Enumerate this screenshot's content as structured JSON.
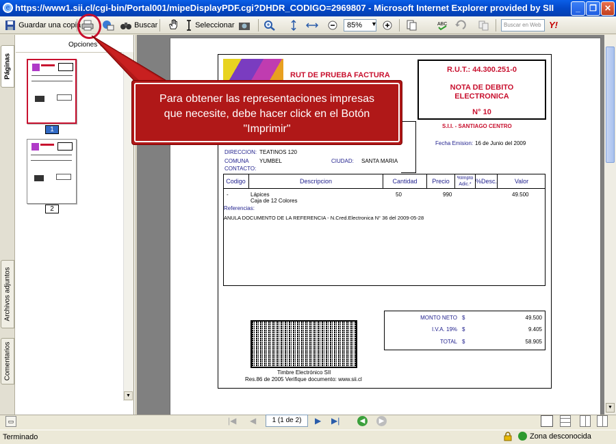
{
  "window": {
    "title": "https://www1.sii.cl/cgi-bin/Portal001/mipeDisplayPDF.cgi?DHDR_CODIGO=2969807 - Microsoft Internet Explorer provided by SII"
  },
  "toolbar": {
    "save_label": "Guardar una copia",
    "search_label": "Buscar",
    "select_label": "Seleccionar",
    "zoom_value": "85%",
    "search_web_placeholder": "Buscar en Web",
    "yahoo_label": "Y!"
  },
  "left_tabs": {
    "pages": "Páginas",
    "attachments": "Archivos adjuntos",
    "comments": "Comentarios"
  },
  "pages_panel": {
    "options_label": "Opciones ▾",
    "thumbnails": [
      {
        "page": "1"
      },
      {
        "page": "2"
      }
    ]
  },
  "callout": {
    "text_lines": [
      "Para obtener las representaciones impresas",
      "que necesite, debe hacer click en el Botón",
      "\"Imprimir\""
    ]
  },
  "document": {
    "issuer": "RUT DE PRUEBA FACTURA",
    "rut_box": {
      "rut": "R.U.T.: 44.300.251-0",
      "doc_type": "NOTA DE DEBITO",
      "doc_type2": "ELECTRONICA",
      "number": "N° 10"
    },
    "office": "S.I.I. - SANTIAGO CENTRO",
    "emission_label": "Fecha Emision:",
    "emission_date": "16 de Junio del 2009",
    "client": {
      "direccion_label": "DIRECCION:",
      "direccion": "TEATINOS 120",
      "comuna_label": "COMUNA",
      "comuna": "YUMBEL",
      "ciudad_label": "CIUDAD:",
      "ciudad": "SANTA MARIA",
      "contacto_label": "CONTACTO:"
    },
    "table_headers": [
      "Codigo",
      "Descripcion",
      "Cantidad",
      "Precio",
      "%Impto Adic.*",
      "%Desc.",
      "Valor"
    ],
    "rows": [
      {
        "codigo": "-",
        "descripcion": "Lápices",
        "descripcion2": "Caja de 12 Colores",
        "cantidad": "50",
        "precio": "990",
        "valor": "49.500"
      }
    ],
    "referencias_label": "Referencias:",
    "referencia": "ANULA DOCUMENTO DE LA REFERENCIA - N.Cred.Electronica N° 36 del 2009-05-28",
    "totals": [
      {
        "label": "MONTO NETO",
        "currency": "$",
        "value": "49.500"
      },
      {
        "label": "I.V.A. 19%",
        "currency": "$",
        "value": "9.405"
      },
      {
        "label": "TOTAL",
        "currency": "$",
        "value": "58.905"
      }
    ],
    "timbre": "Timbre Electrónico SII",
    "timbre2": "Res.86 de 2005 Verifique documento: www.sii.cl"
  },
  "nav": {
    "page_indicator": "1 (1 de 2)"
  },
  "status": {
    "left": "Terminado",
    "zone": "Zona desconocida"
  },
  "colors": {
    "title_blue": "#0348C8",
    "callout_red": "#B01818",
    "doc_red": "#C8102E",
    "doc_navy": "#1E1E8C"
  }
}
